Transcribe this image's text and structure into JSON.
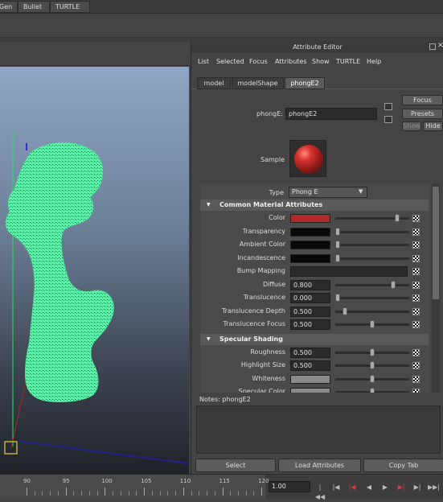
{
  "shelf": {
    "tabs": [
      "Gen",
      "Bullet",
      "TURTLE"
    ]
  },
  "attribute_editor": {
    "title": "Attribute Editor",
    "menu": [
      "List",
      "Selected",
      "Focus",
      "Attributes",
      "Show",
      "TURTLE",
      "Help"
    ],
    "tabs": [
      {
        "label": "model",
        "active": false
      },
      {
        "label": "modelShape",
        "active": false
      },
      {
        "label": "phongE2",
        "active": true
      }
    ],
    "node_label": "phongE:",
    "node_name": "phongE2",
    "buttons": {
      "focus": "Focus",
      "presets": "Presets",
      "show": "Show",
      "hide": "Hide"
    },
    "sample_label": "Sample",
    "type_label": "Type",
    "type_value": "Phong E",
    "sections": {
      "common": "Common Material Attributes",
      "specular": "Specular Shading"
    },
    "common_rows": [
      {
        "label": "Color",
        "kind": "swatch",
        "swatch": "#b22a2a",
        "slider": 0.86
      },
      {
        "label": "Transparency",
        "kind": "swatch",
        "swatch": "#080808",
        "slider": 0.0
      },
      {
        "label": "Ambient Color",
        "kind": "swatch",
        "swatch": "#080808",
        "slider": 0.0
      },
      {
        "label": "Incandescence",
        "kind": "swatch",
        "swatch": "#080808",
        "slider": 0.0
      },
      {
        "label": "Bump Mapping",
        "kind": "bump"
      },
      {
        "label": "Diffuse",
        "kind": "value",
        "value": "0.800",
        "slider": 0.8
      },
      {
        "label": "Translucence",
        "kind": "value",
        "value": "0.000",
        "slider": 0.0
      },
      {
        "label": "Translucence Depth",
        "kind": "value",
        "value": "0.500",
        "slider": 0.1
      },
      {
        "label": "Translucence Focus",
        "kind": "value",
        "value": "0.500",
        "slider": 0.5
      }
    ],
    "specular_rows": [
      {
        "label": "Roughness",
        "kind": "value",
        "value": "0.500",
        "slider": 0.5
      },
      {
        "label": "Highlight Size",
        "kind": "value",
        "value": "0.500",
        "slider": 0.5
      },
      {
        "label": "Whiteness",
        "kind": "swatch",
        "swatch": "#8a8a8a",
        "slider": 0.5
      },
      {
        "label": "Specular Color",
        "kind": "swatch",
        "swatch": "#8a8a8a",
        "slider": 0.5
      }
    ],
    "notes_title": "Notes:  phongE2",
    "bottom_buttons": {
      "select": "Select",
      "load": "Load Attributes",
      "copy": "Copy Tab"
    }
  },
  "timeline": {
    "ticks": [
      "90",
      "95",
      "100",
      "105",
      "110",
      "115",
      "120"
    ],
    "current_frame": "1.00"
  },
  "colors": {
    "model_fill": "#5cf0a8",
    "accent_red": "#b22a2a"
  }
}
